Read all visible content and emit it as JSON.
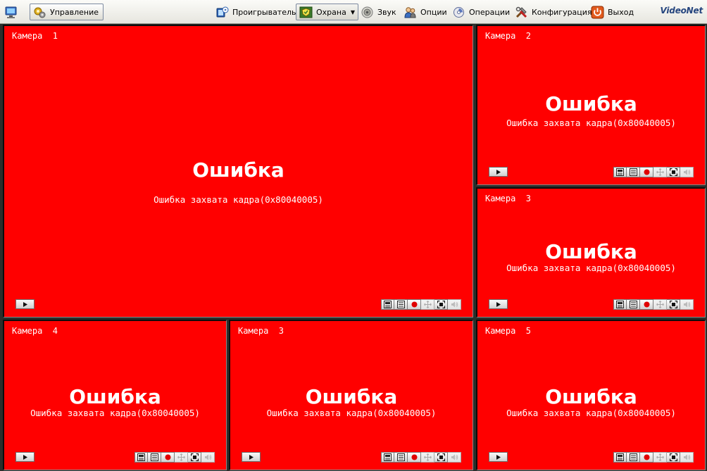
{
  "toolbar": {
    "management_label": "Управление",
    "player_label": "Проигрыватель",
    "guard_label": "Охрана",
    "sound_label": "Звук",
    "options_label": "Опции",
    "operations_label": "Операции",
    "config_label": "Конфигурация",
    "exit_label": "Выход",
    "brand": "VideoNet"
  },
  "cameras": [
    {
      "title": "Камера  1",
      "error": "Ошибка",
      "message": "Ошибка захвата кадра(0x80040005)"
    },
    {
      "title": "Камера  2",
      "error": "Ошибка",
      "message": "Ошибка захвата кадра(0x80040005)"
    },
    {
      "title": "Камера  3",
      "error": "Ошибка",
      "message": "Ошибка захвата кадра(0x80040005)"
    },
    {
      "title": "Камера  4",
      "error": "Ошибка",
      "message": "Ошибка захвата кадра(0x80040005)"
    },
    {
      "title": "Камера  3",
      "error": "Ошибка",
      "message": "Ошибка захвата кадра(0x80040005)"
    },
    {
      "title": "Камера  5",
      "error": "Ошибка",
      "message": "Ошибка захвата кадра(0x80040005)"
    }
  ],
  "colors": {
    "error_background": "#ff0000",
    "grid_background": "#2b2e2b",
    "record_dot": "#e00000"
  },
  "icons": {
    "management": "computer-icon",
    "guard": "shield-icon",
    "player": "film-icon",
    "sound": "speaker-icon",
    "options": "users-icon",
    "operations": "gears-icon",
    "config": "tools-icon",
    "exit": "power-icon",
    "camera_controls": [
      "layout-icon",
      "list-icon",
      "record-icon",
      "ptz-icon",
      "fullscreen-icon",
      "audio-icon"
    ]
  }
}
